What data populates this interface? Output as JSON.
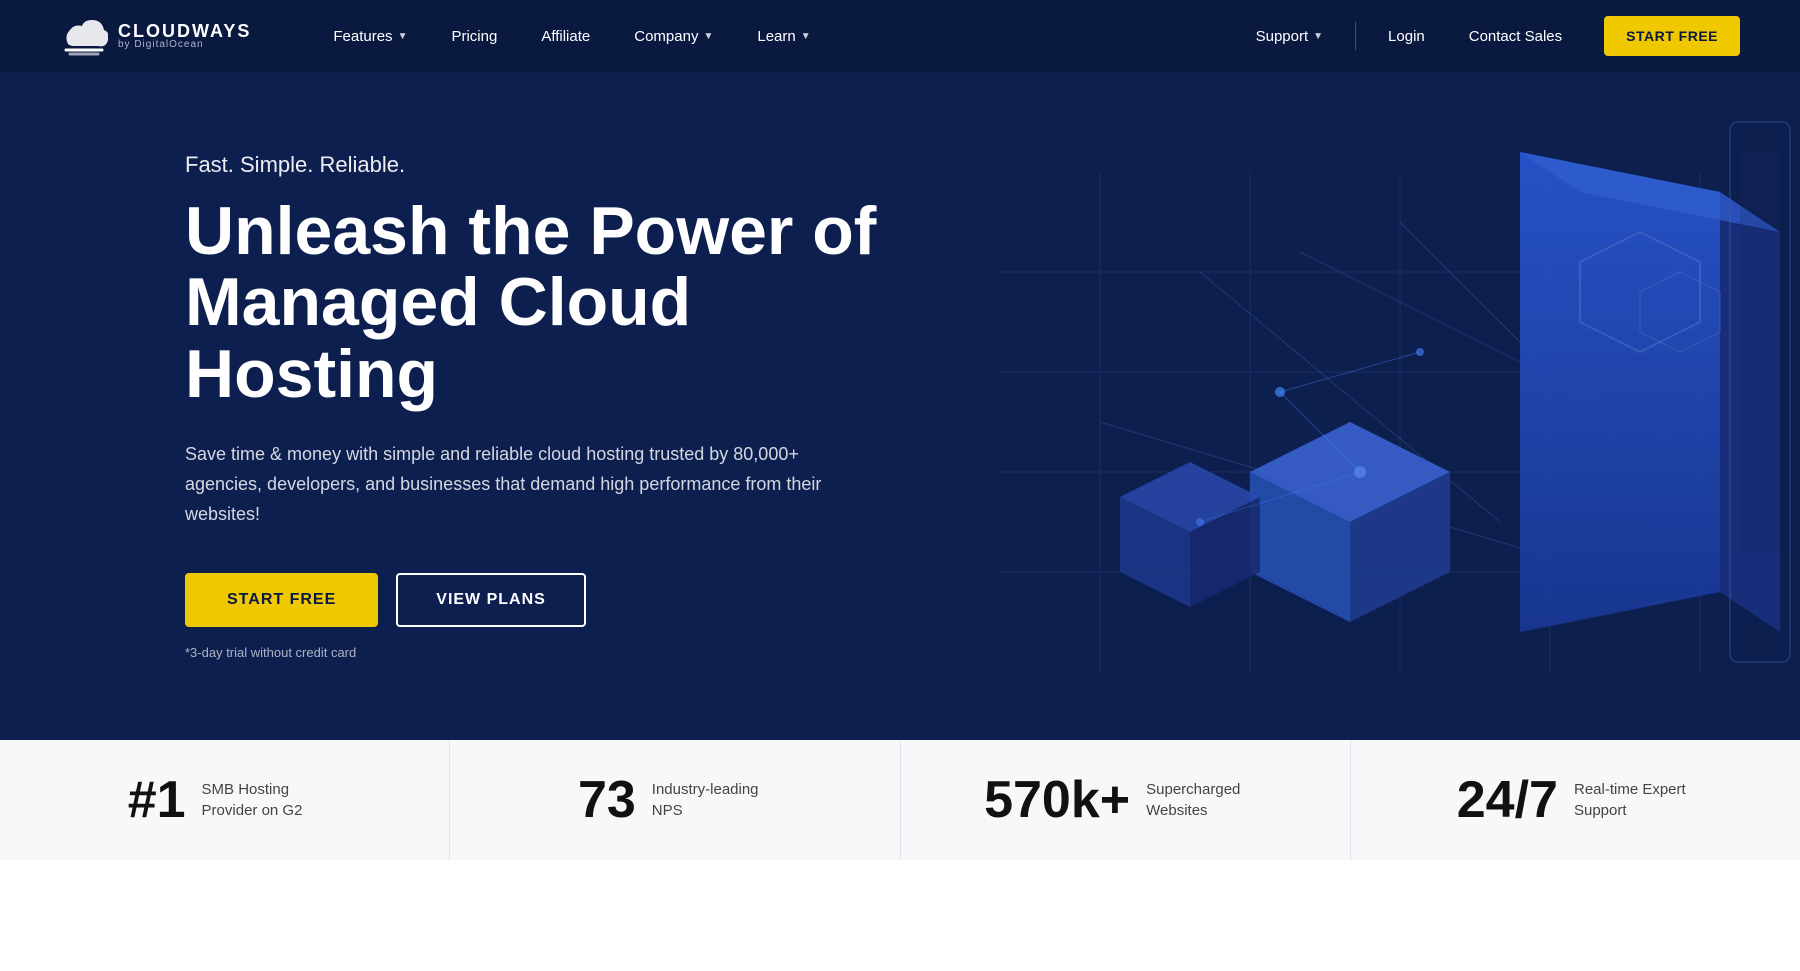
{
  "brand": {
    "name": "CLOUDWAYS",
    "sub": "by DigitalOcean"
  },
  "nav": {
    "items": [
      {
        "label": "Features",
        "hasDropdown": true
      },
      {
        "label": "Pricing",
        "hasDropdown": false
      },
      {
        "label": "Affiliate",
        "hasDropdown": false
      },
      {
        "label": "Company",
        "hasDropdown": true
      },
      {
        "label": "Learn",
        "hasDropdown": true
      }
    ],
    "right_items": [
      {
        "label": "Support",
        "hasDropdown": true
      },
      {
        "label": "Login",
        "hasDropdown": false
      },
      {
        "label": "Contact Sales",
        "hasDropdown": false
      }
    ],
    "cta_label": "START FREE"
  },
  "hero": {
    "tagline": "Fast. Simple. Reliable.",
    "title_line1": "Unleash the Power of",
    "title_line2": "Managed Cloud Hosting",
    "description": "Save time & money with simple and reliable cloud hosting trusted by 80,000+ agencies, developers, and businesses that demand high performance from their websites!",
    "cta_primary": "START FREE",
    "cta_secondary": "VIEW PLANS",
    "trial_note": "*3-day trial without credit card"
  },
  "stats": [
    {
      "number": "#1",
      "label": "SMB Hosting Provider on G2"
    },
    {
      "number": "73",
      "label": "Industry-leading NPS"
    },
    {
      "number": "570k+",
      "label": "Supercharged Websites"
    },
    {
      "number": "24/7",
      "label": "Real-time Expert Support"
    }
  ]
}
